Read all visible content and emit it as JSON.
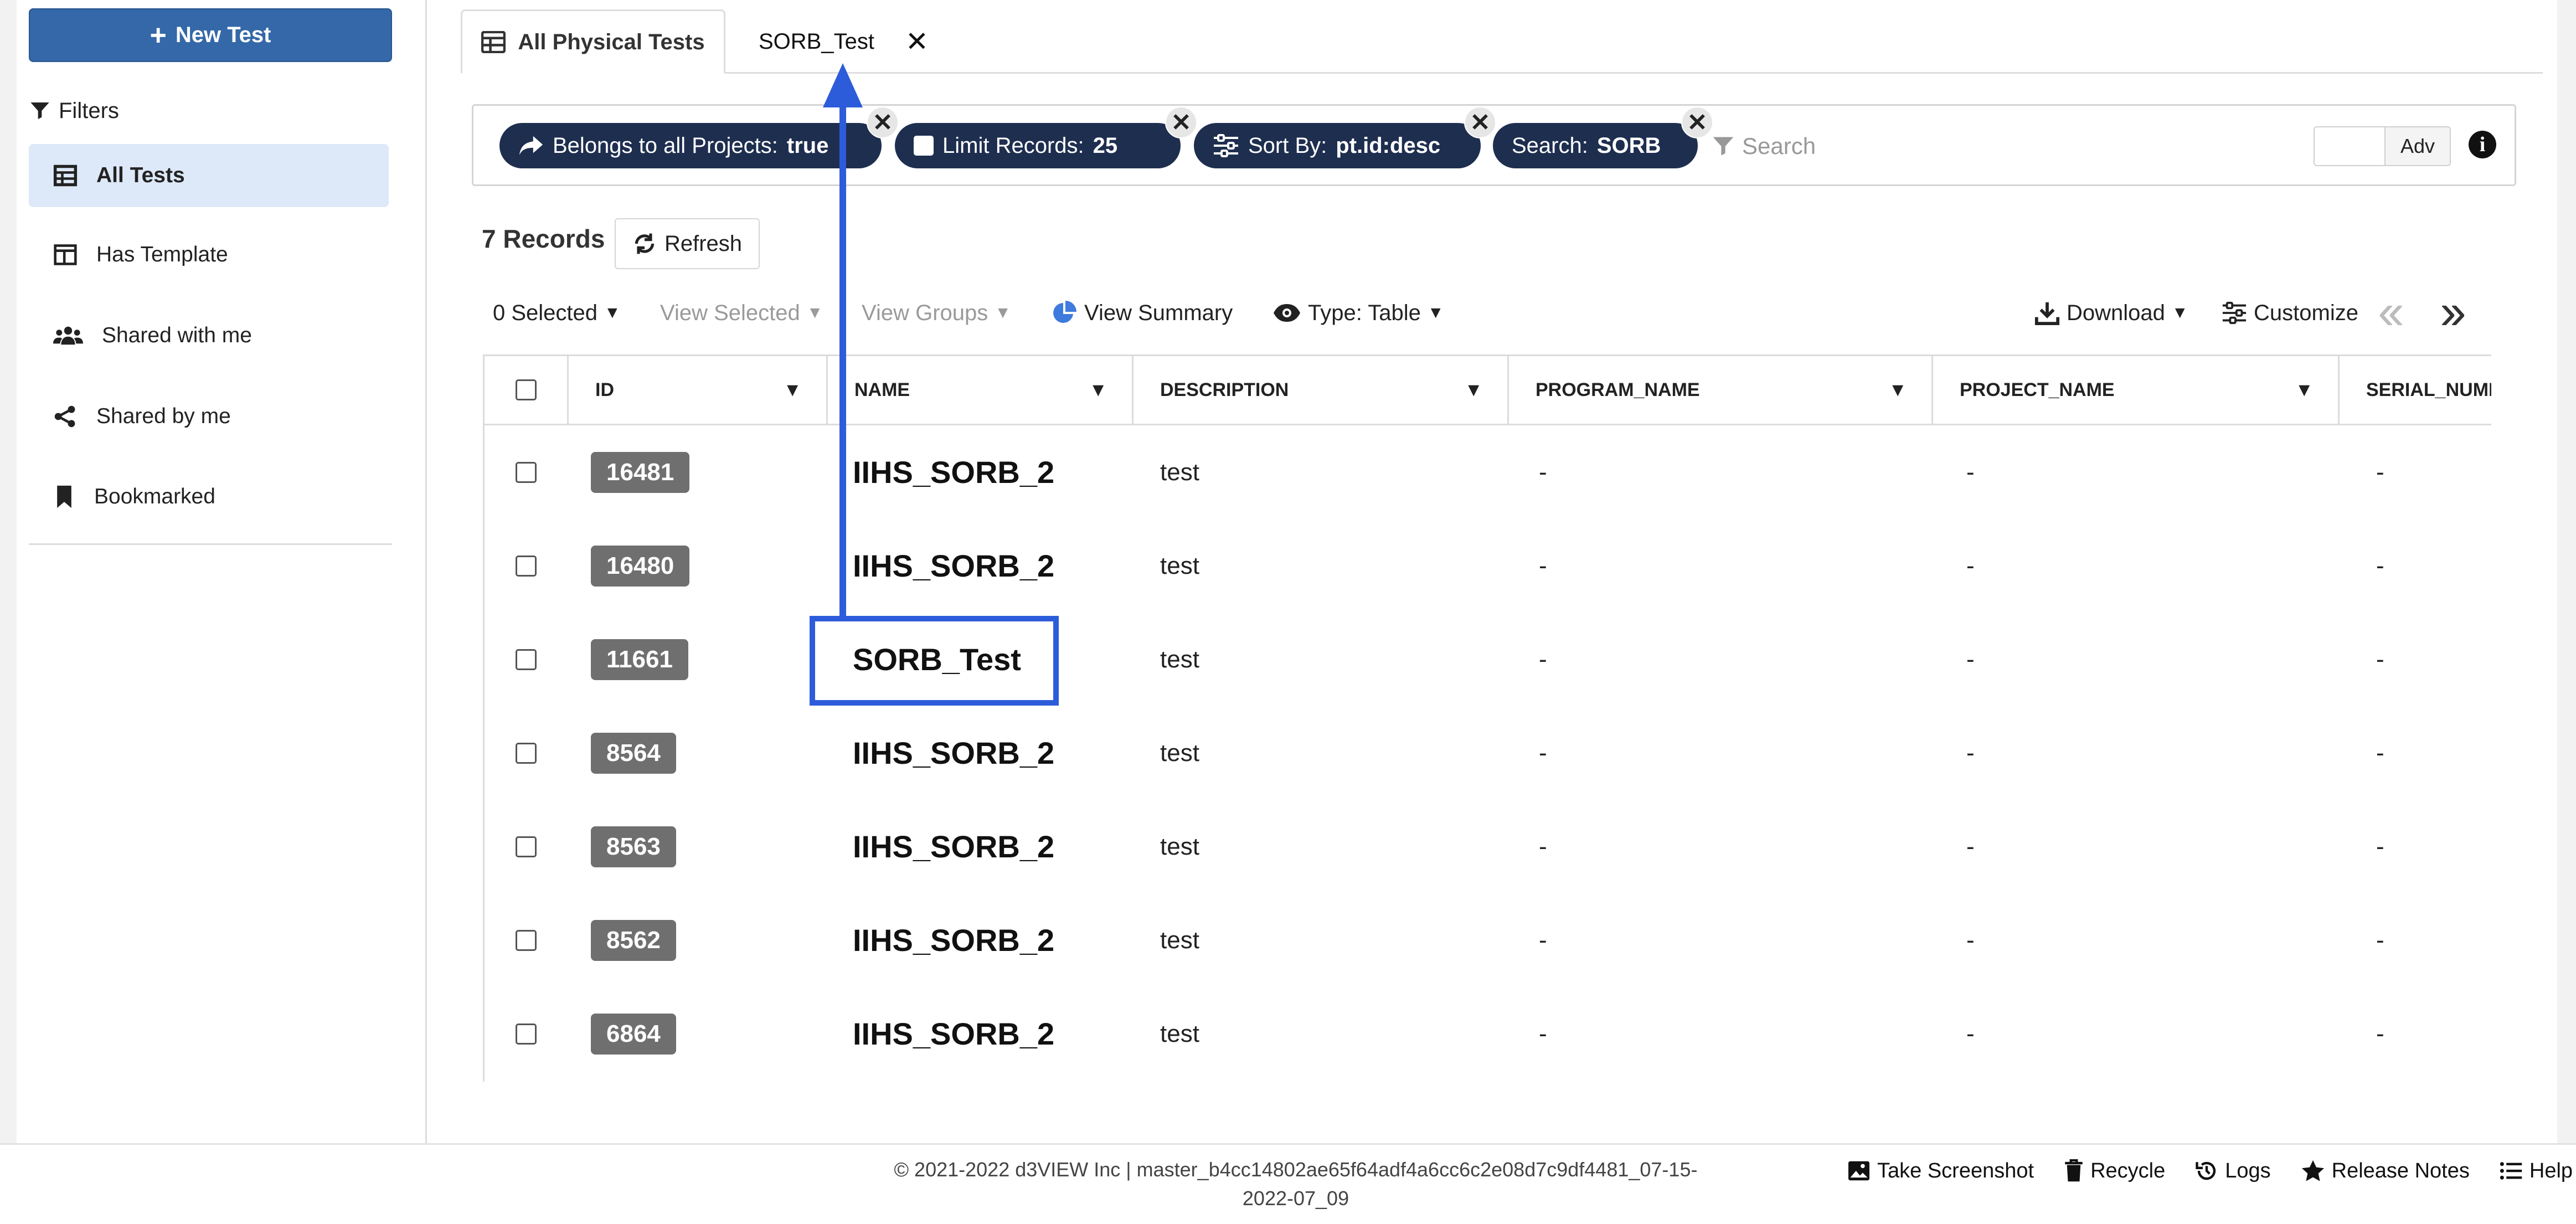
{
  "sidebar": {
    "new_test_label": "New Test",
    "filters_label": "Filters",
    "items": [
      {
        "label": "All Tests",
        "icon": "table-icon",
        "active": true
      },
      {
        "label": "Has Template",
        "icon": "layout-icon",
        "active": false
      },
      {
        "label": "Shared with me",
        "icon": "users-icon",
        "active": false
      },
      {
        "label": "Shared by me",
        "icon": "share-icon",
        "active": false
      },
      {
        "label": "Bookmarked",
        "icon": "bookmark-icon",
        "active": false
      }
    ]
  },
  "tabs": [
    {
      "label": "All Physical Tests",
      "active": true,
      "icon": "table-icon"
    },
    {
      "label": "SORB_Test",
      "active": false,
      "closable": true
    }
  ],
  "filter_pills": [
    {
      "label": "Belongs to all Projects:",
      "value": "true",
      "icon": "share-arrow-icon"
    },
    {
      "label": "Limit Records:",
      "value": "25",
      "icon": "checkbox-icon"
    },
    {
      "label": "Sort By:",
      "value": "pt.id:desc",
      "icon": "sliders-icon"
    },
    {
      "label": "Search:",
      "value": "SORB",
      "icon": ""
    }
  ],
  "search": {
    "placeholder": "Search",
    "value": ""
  },
  "adv_label": "Adv",
  "records": {
    "count_label": "7 Records",
    "refresh_label": "Refresh"
  },
  "toolbar": {
    "selected_label": "0 Selected",
    "view_selected_label": "View Selected",
    "view_groups_label": "View Groups",
    "view_summary_label": "View Summary",
    "type_label": "Type: Table",
    "download_label": "Download",
    "customize_label": "Customize"
  },
  "table": {
    "columns": [
      "ID",
      "NAME",
      "DESCRIPTION",
      "PROGRAM_NAME",
      "PROJECT_NAME",
      "SERIAL_NUMBER"
    ],
    "rows": [
      {
        "id": "16481",
        "name": "IIHS_SORB_2",
        "description": "test",
        "program_name": "-",
        "project_name": "-",
        "serial_number": "-"
      },
      {
        "id": "16480",
        "name": "IIHS_SORB_2",
        "description": "test",
        "program_name": "-",
        "project_name": "-",
        "serial_number": "-"
      },
      {
        "id": "11661",
        "name": "SORB_Test",
        "description": "test",
        "program_name": "-",
        "project_name": "-",
        "serial_number": "-"
      },
      {
        "id": "8564",
        "name": "IIHS_SORB_2",
        "description": "test",
        "program_name": "-",
        "project_name": "-",
        "serial_number": "-"
      },
      {
        "id": "8563",
        "name": "IIHS_SORB_2",
        "description": "test",
        "program_name": "-",
        "project_name": "-",
        "serial_number": "-"
      },
      {
        "id": "8562",
        "name": "IIHS_SORB_2",
        "description": "test",
        "program_name": "-",
        "project_name": "-",
        "serial_number": "-"
      },
      {
        "id": "6864",
        "name": "IIHS_SORB_2",
        "description": "test",
        "program_name": "-",
        "project_name": "-",
        "serial_number": "-"
      }
    ]
  },
  "footer": {
    "copyright_line1": "© 2021-2022 d3VIEW Inc | master_b4cc14802ae65f64adf4a6cc6c2e08d7c9df4481_07-15-",
    "copyright_line2": "2022-07_09",
    "links": [
      "Take Screenshot",
      "Recycle",
      "Logs",
      "Release Notes",
      "Help"
    ]
  },
  "colors": {
    "primary": "#3468a8",
    "pill_bg": "#1e2e4f",
    "annotation": "#2d5cdb",
    "badge": "#6f6f6f",
    "active_item": "#dde9f8"
  }
}
